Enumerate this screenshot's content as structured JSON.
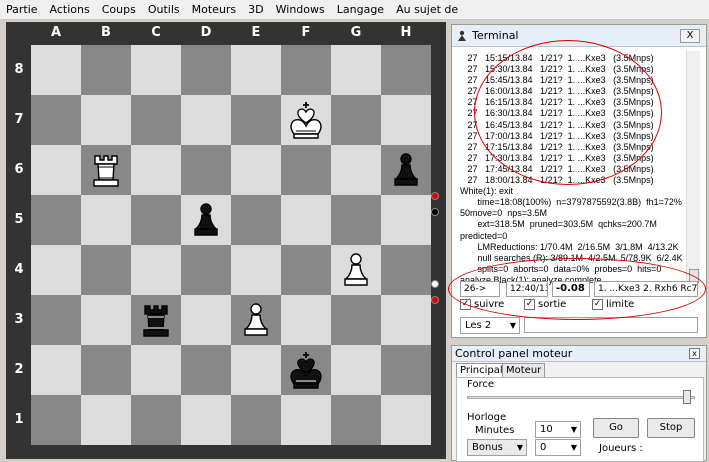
{
  "menu": [
    "Partie",
    "Actions",
    "Coups",
    "Outils",
    "Moteurs",
    "3D",
    "Windows",
    "Langage",
    "Au sujet de"
  ],
  "board": {
    "files": [
      "A",
      "B",
      "C",
      "D",
      "E",
      "F",
      "G",
      "H"
    ],
    "ranks": [
      "8",
      "7",
      "6",
      "5",
      "4",
      "3",
      "2",
      "1"
    ],
    "light_color": "#dcdcdc",
    "dark_color": "#888888",
    "pieces": [
      {
        "square": "f7",
        "piece": "king",
        "color": "white",
        "icon": "white-king-icon"
      },
      {
        "square": "b6",
        "piece": "rook",
        "color": "white",
        "icon": "white-rook-icon"
      },
      {
        "square": "h6",
        "piece": "pawn",
        "color": "black",
        "icon": "black-pawn-icon"
      },
      {
        "square": "d5",
        "piece": "pawn",
        "color": "black",
        "icon": "black-pawn-icon"
      },
      {
        "square": "g4",
        "piece": "pawn",
        "color": "white",
        "icon": "white-pawn-icon"
      },
      {
        "square": "c3",
        "piece": "rook",
        "color": "black",
        "icon": "black-rook-icon"
      },
      {
        "square": "e3",
        "piece": "pawn",
        "color": "white",
        "icon": "white-pawn-icon"
      },
      {
        "square": "f2",
        "piece": "king",
        "color": "black",
        "icon": "black-king-icon"
      }
    ]
  },
  "terminal": {
    "title": "Terminal",
    "close_label": "X",
    "log": [
      "   27   15:15/13.84   1/21?  1. ...Kxe3   (3.5Mnps)",
      "   27   15:30/13.84   1/21?  1. ...Kxe3   (3.5Mnps)",
      "   27   15:45/13.84   1/21?  1. ...Kxe3   (3.5Mnps)",
      "   27   16:00/13.84   1/21?  1. ...Kxe3   (3.5Mnps)",
      "   27   16:15/13.84   1/21?  1. ...Kxe3   (3.5Mnps)",
      "   27   16:30/13.84   1/21?  1. ...Kxe3   (3.5Mnps)",
      "   27   16:45/13.84   1/21?  1. ...Kxe3   (3.5Mnps)",
      "   27   17:00/13.84   1/21?  1. ...Kxe3   (3.5Mnps)",
      "   27   17:15/13.84   1/21?  1. ...Kxe3   (3.5Mnps)",
      "   27   17:30/13.84   1/21?  1. ...Kxe3   (3.5Mnps)",
      "   27   17:45/13.84   1/21?  1. ...Kxe3   (3.5Mnps)",
      "   27   18:00/13.84   1/21?  1. ...Kxe3   (3.5Mnps)",
      "White(1): exit",
      "       time=18:08(100%)  n=3797875592(3.8B)  fh1=72%",
      "50move=0  nps=3.5M",
      "       ext=318.5M  pruned=303.5M  qchks=200.7M",
      "predicted=0",
      "       LMReductions: 1/70.4M  2/16.5M  3/1.8M  4/13.2K",
      "       null searches (R): 3/89.1M  4/2.5M  5/78.9K  6/2.4K  7/5",
      "       splits=0  aborts=0  data=0%  probes=0  hits=0",
      "analyze Black(1): analyze complete."
    ],
    "depth_field": "26->",
    "time_field": "12:40/13.8",
    "score_field": "-0.08",
    "pv_field": "1. ...Kxe3 2. Rxh6 Rc7+ 3. Kf",
    "checkboxes": [
      {
        "label": "suivre",
        "checked": true
      },
      {
        "label": "sortie",
        "checked": true
      },
      {
        "label": "limite",
        "checked": true
      }
    ],
    "lines_select": "Les 2"
  },
  "control_panel": {
    "title": "Control panel moteur",
    "close_label": "x",
    "tabs": [
      "Principale",
      "Moteur"
    ],
    "force_label": "Force",
    "horloge_label": "Horloge",
    "minutes_label": "Minutes",
    "minutes_value": "10",
    "bonus_label": "Bonus",
    "bonus_value": "0",
    "go_label": "Go",
    "stop_label": "Stop",
    "joueurs_label": "Joueurs :"
  }
}
